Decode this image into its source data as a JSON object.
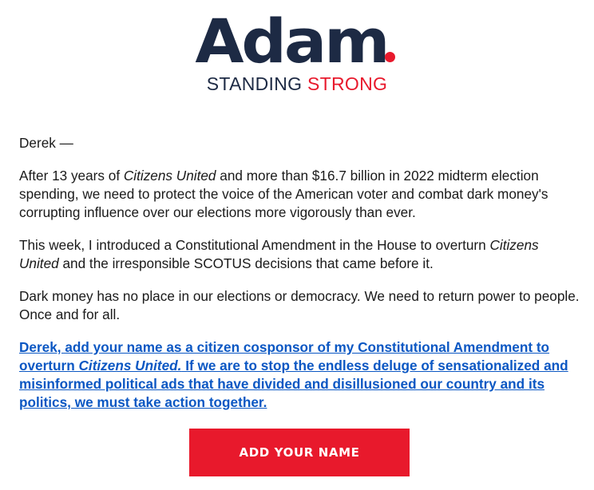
{
  "colors": {
    "navy": "#1d2a44",
    "brand_red": "#e8192c",
    "link_blue": "#0b57c3",
    "button_text": "#ffffff"
  },
  "header": {
    "logo_text": "Adam",
    "tagline_part1": "STANDING ",
    "tagline_part2": "STRONG"
  },
  "email": {
    "greeting": "Derek —",
    "p1_a": "After 13 years of ",
    "p1_italic": "Citizens United",
    "p1_b": " and more than $16.7 billion in 2022 midterm election spending, we need to protect the voice of the American voter and combat dark money's corrupting influence over our elections more vigorously than ever.",
    "p2_a": "This week, I introduced a Constitutional Amendment in the House to overturn ",
    "p2_italic": "Citizens United",
    "p2_b": " and the irresponsible SCOTUS decisions that came before it.",
    "p3": "Dark money has no place in our elections or democracy. We need to return power to people. Once and for all.",
    "link_a": "Derek, add your name as a citizen cosponsor of my Constitutional Amendment to overturn ",
    "link_italic": "Citizens United.",
    "link_b": " If we are to stop the endless deluge of sensationalized and misinformed political ads that have divided and disillusioned our country and its politics, we must take action together."
  },
  "cta": {
    "label": "ADD YOUR NAME"
  }
}
